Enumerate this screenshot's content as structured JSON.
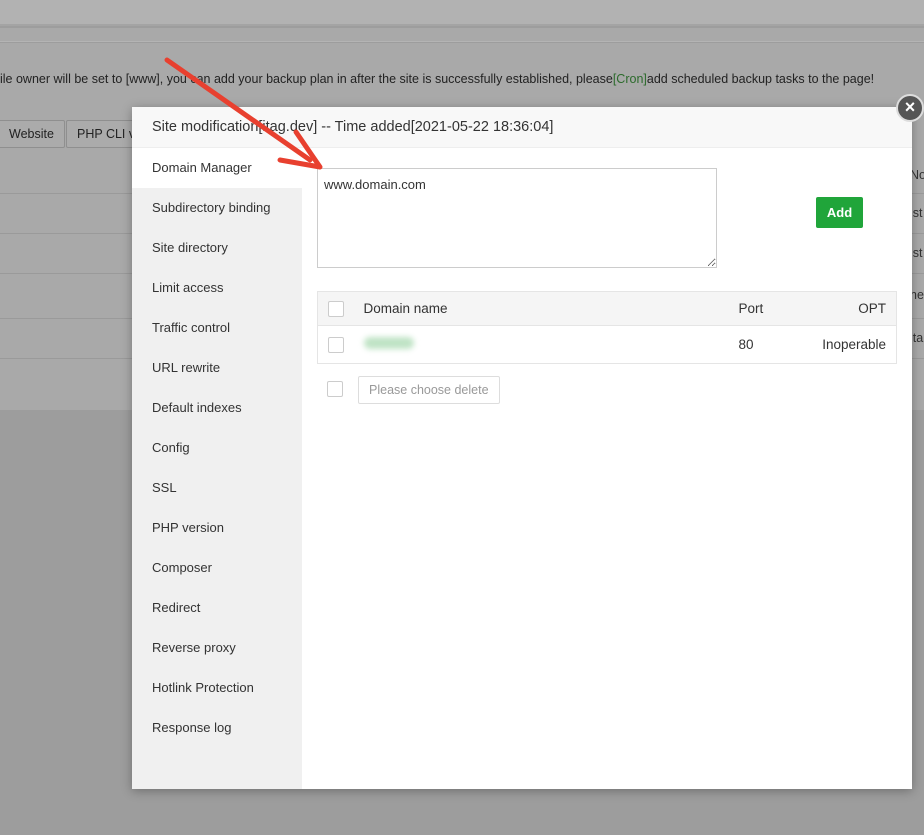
{
  "background": {
    "notice_pre": "ile owner will be set to [www], you can add your backup plan in after the site is successfully established, please",
    "notice_link": "[Cron]",
    "notice_post": "add scheduled backup tasks to the page!",
    "buttons": [
      "Website",
      "PHP CLI v"
    ],
    "right_cells": [
      "No",
      "ist",
      "ist",
      "ne",
      "ita"
    ]
  },
  "modal": {
    "title": "Site modification[itag.dev] -- Time added[2021-05-22 18:36:04]",
    "close_icon": "×",
    "sidebar": [
      "Domain Manager",
      "Subdirectory binding",
      "Site directory",
      "Limit access",
      "Traffic control",
      "URL rewrite",
      "Default indexes",
      "Config",
      "SSL",
      "PHP version",
      "Composer",
      "Redirect",
      "Reverse proxy",
      "Hotlink Protection",
      "Response log"
    ],
    "domain_input": "www.domain.com",
    "add_label": "Add",
    "table": {
      "headers": [
        "Domain name",
        "Port",
        "OPT"
      ],
      "rows": [
        {
          "port": "80",
          "opt": "Inoperable"
        }
      ]
    },
    "delete_label": "Please choose delete"
  },
  "colors": {
    "accent": "#20a53a",
    "arrow": "#e8402f"
  }
}
